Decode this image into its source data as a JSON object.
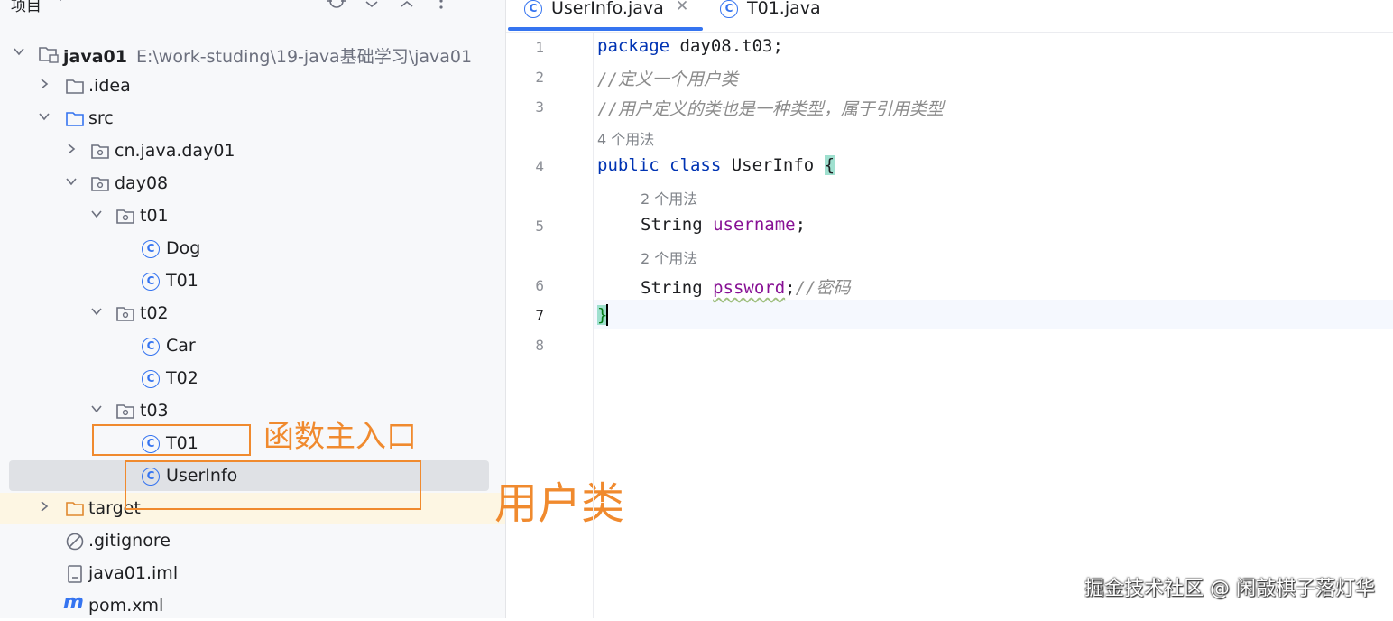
{
  "project": {
    "title": "项目",
    "tree": [
      {
        "label": "java01",
        "path": "E:\\work-studing\\19-java基础学习\\java01",
        "icon": "module-folder-icon",
        "expanded": true
      },
      {
        "label": ".idea",
        "icon": "folder-icon",
        "expanded": false
      },
      {
        "label": "src",
        "icon": "source-folder-icon",
        "expanded": true
      },
      {
        "label": "cn.java.day01",
        "icon": "package-icon",
        "expanded": false
      },
      {
        "label": "day08",
        "icon": "package-icon",
        "expanded": true
      },
      {
        "label": "t01",
        "icon": "package-icon",
        "expanded": true
      },
      {
        "label": "Dog",
        "icon": "class-icon"
      },
      {
        "label": "T01",
        "icon": "class-icon"
      },
      {
        "label": "t02",
        "icon": "package-icon",
        "expanded": true
      },
      {
        "label": "Car",
        "icon": "class-icon"
      },
      {
        "label": "T02",
        "icon": "class-icon"
      },
      {
        "label": "t03",
        "icon": "package-icon",
        "expanded": true
      },
      {
        "label": "T01",
        "icon": "class-icon"
      },
      {
        "label": "UserInfo",
        "icon": "class-icon",
        "selected": true
      },
      {
        "label": "target",
        "icon": "excluded-folder-icon",
        "expanded": false
      },
      {
        "label": ".gitignore",
        "icon": "ignore-file-icon"
      },
      {
        "label": "java01.iml",
        "icon": "iml-file-icon"
      },
      {
        "label": "pom.xml",
        "icon": "maven-icon"
      }
    ]
  },
  "annotations": {
    "main_entry": "函数主入口",
    "user_class": "用户类"
  },
  "editor": {
    "tabs": [
      {
        "label": "UserInfo.java",
        "active": true
      },
      {
        "label": "T01.java",
        "active": false
      }
    ],
    "line_numbers": [
      "1",
      "2",
      "3",
      "4",
      "5",
      "6",
      "7",
      "8"
    ],
    "hints": {
      "class_usages": "4 个用法",
      "username_usages": "2 个用法",
      "pssword_usages": "2 个用法"
    },
    "code": {
      "l1_kw": "package",
      "l1_rest": " day08.t03;",
      "l2": "//定义一个用户类",
      "l3": "//用户定义的类也是一种类型，属于引用类型",
      "l4_kw": "public class",
      "l4_name": " UserInfo ",
      "l4_brace": "{",
      "l5_type": "String ",
      "l5_field": "username",
      "l5_end": ";",
      "l6_type": "String ",
      "l6_field": "pssword",
      "l6_end": ";",
      "l6_comment": "//密码",
      "l7_brace": "}"
    }
  },
  "watermark": "掘金技术社区 @ 闲敲棋子落灯华",
  "colors": {
    "accent": "#3574f0",
    "keyword": "#0033b3",
    "field": "#871094",
    "comment": "#8c8c8c",
    "annotation": "#f08a2e"
  }
}
